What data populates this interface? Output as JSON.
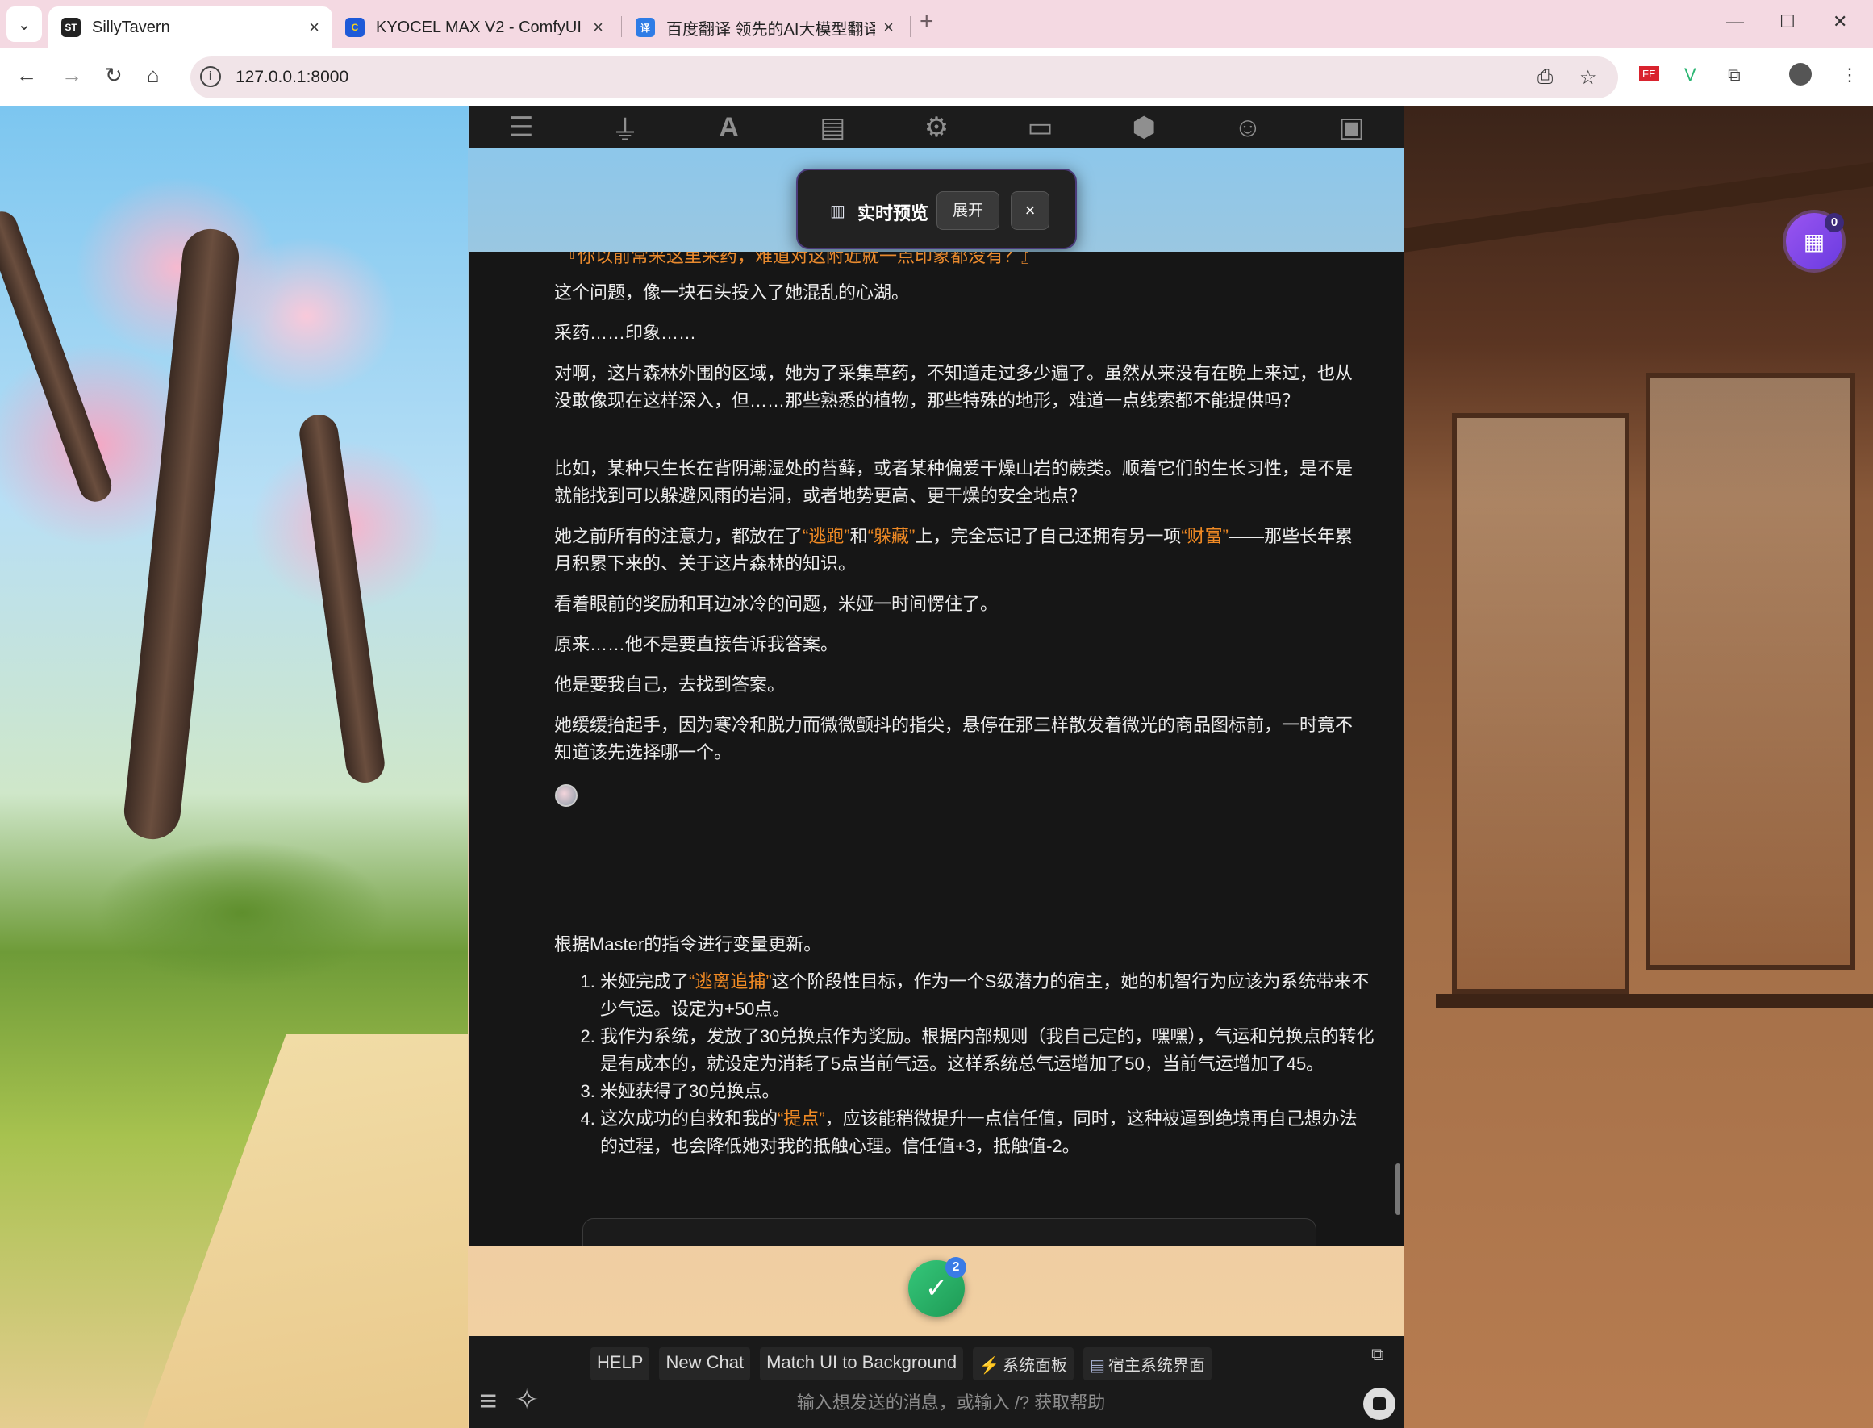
{
  "browser": {
    "tabs": [
      {
        "title": "SillyTavern",
        "favicon": "ST",
        "active": true
      },
      {
        "title": "KYOCEL MAX V2 - ComfyUI",
        "favicon": "C",
        "active": false
      },
      {
        "title": "百度翻译 领先的AI大模型翻译",
        "favicon": "译",
        "active": false
      }
    ],
    "url": "127.0.0.1:8000"
  },
  "st_nav": {
    "icons": [
      "sliders-icon",
      "plug-icon",
      "font-icon",
      "book-icon",
      "user-gear-icon",
      "image-icon",
      "cubes-icon",
      "smile-icon",
      "id-card-icon"
    ]
  },
  "preview": {
    "title": "实时预览",
    "expand_label": "展开",
    "close_label": "×"
  },
  "gallery": {
    "badge": "0"
  },
  "chat": {
    "cut_line": "『你以前常来这里采药，难道对这附近就一点印象都没有？』",
    "paragraphs": [
      {
        "text": "这个问题，像一块石头投入了她混乱的心湖。"
      },
      {
        "text": "采药……印象……"
      },
      {
        "text": "对啊，这片森林外围的区域，她为了采集草药，不知道走过多少遍了。虽然从来没有在晚上来过，也从没敢像现在这样深入，但……那些熟悉的植物，那些特殊的地形，难道一点线索都不能提供吗？"
      },
      {
        "text": "比如，某种只生长在背阴潮湿处的苔藓，或者某种偏爱干燥山岩的蕨类。顺着它们的生长习性，是不是就能找到可以躲避风雨的岩洞，或者地势更高、更干燥的安全地点？"
      },
      {
        "part1": "她之前所有的注意力，都放在了",
        "hl1": "“逃跑”",
        "part2": "和",
        "hl2": "“躲藏”",
        "part3": "上，完全忘记了自己还拥有另一项",
        "hl3": "“财富”",
        "part4": "——那些长年累月积累下来的、关于这片森林的知识。"
      },
      {
        "text": "看着眼前的奖励和耳边冰冷的问题，米娅一时间愣住了。"
      },
      {
        "text": "原来……他不是要直接告诉我答案。"
      },
      {
        "text": "他是要我自己，去找到答案。"
      },
      {
        "text": "她缓缓抬起手，因为寒冷和脱力而微微颤抖的指尖，悬停在那三样散发着微光的商品图标前，一时竟不知道该先选择哪一个。"
      },
      {
        "text": "根据Master的指令进行变量更新。"
      }
    ],
    "list": [
      {
        "pre": "米娅完成了",
        "hl": "“逃离追捕”",
        "post": "这个阶段性目标，作为一个S级潜力的宿主，她的机智行为应该为系统带来不少气运。设定为+50点。"
      },
      {
        "pre": "我作为系统，发放了30兑换点作为奖励。根据内部规则（我自己定的，嘿嘿），气运和兑换点的转化是有成本的，就设定为消耗了5点当前气运。这样系统总气运增加了50，当前气运增加了45。",
        "hl": "",
        "post": ""
      },
      {
        "pre": "米娅获得了30兑换点。",
        "hl": "",
        "post": ""
      },
      {
        "pre": "这次成功的自救和我的",
        "hl": "“提点”",
        "post": "，应该能稍微提升一点信任值，同时，这种被逼到绝境再自己想办法的过程，也会降低她对我的抵触心理。信任值+3，抵触值-2。"
      }
    ]
  },
  "check": {
    "badge": "2"
  },
  "bottom": {
    "quick_replies": [
      "HELP",
      "New Chat",
      "Match UI to Background"
    ],
    "system_panel": "系统面板",
    "host_ui": "宿主系统界面",
    "input_placeholder": "输入想发送的消息，或输入 /? 获取帮助"
  },
  "colors": {
    "highlight": "#f08a24",
    "chat_bg": "#161616",
    "accent_purple": "#7a45e8",
    "check_green": "#28b066"
  }
}
